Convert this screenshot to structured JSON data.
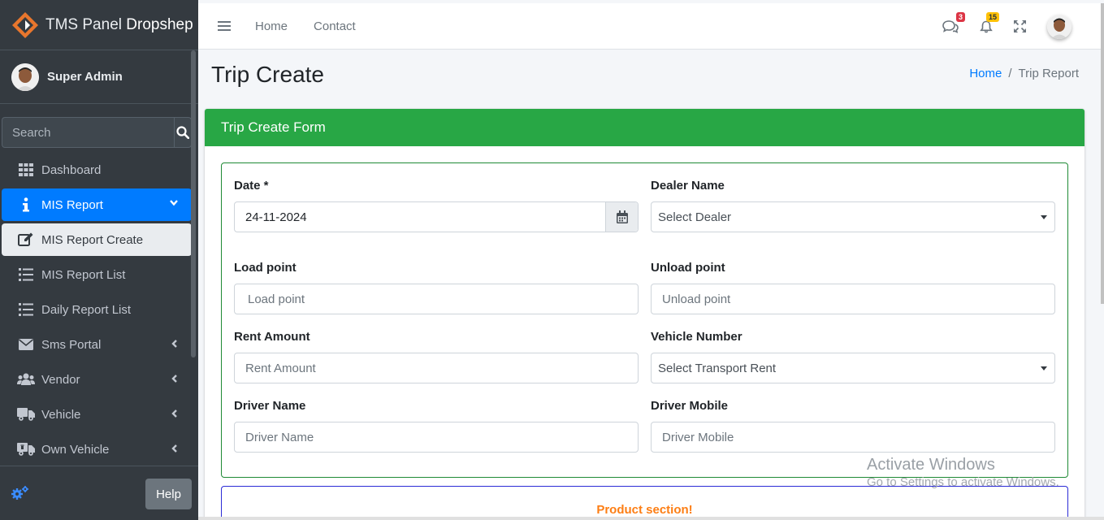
{
  "brand": {
    "name_light": "TMS Panel",
    "name_bold": "Dropshep"
  },
  "user": {
    "name": "Super Admin"
  },
  "sidebar": {
    "search_placeholder": "Search",
    "items": [
      {
        "label": "Dashboard",
        "icon": "th-icon"
      },
      {
        "label": "MIS Report",
        "icon": "info-icon"
      },
      {
        "label": "MIS Report Create",
        "icon": "edit-icon"
      },
      {
        "label": "MIS Report List",
        "icon": "list-icon"
      },
      {
        "label": "Daily Report List",
        "icon": "list-icon"
      },
      {
        "label": "Sms Portal",
        "icon": "envelope-icon"
      },
      {
        "label": "Vendor",
        "icon": "users-icon"
      },
      {
        "label": "Vehicle",
        "icon": "truck-icon"
      },
      {
        "label": "Own Vehicle",
        "icon": "truck-icon"
      }
    ],
    "help_label": "Help"
  },
  "topnav": {
    "home": "Home",
    "contact": "Contact",
    "messages_count": "3",
    "notifications_count": "15"
  },
  "page": {
    "title": "Trip Create",
    "breadcrumb_home": "Home",
    "breadcrumb_sep": "/",
    "breadcrumb_current": "Trip Report"
  },
  "form": {
    "header": "Trip Create Form",
    "date_label": "Date *",
    "date_value": "24-11-2024",
    "dealer_label": "Dealer Name",
    "dealer_value": "Select Dealer",
    "load_label": "Load point",
    "load_placeholder": "Load point",
    "unload_label": "Unload point",
    "unload_placeholder": "Unload point",
    "rent_label": "Rent Amount",
    "rent_placeholder": "Rent Amount",
    "vehicle_label": "Vehicle Number",
    "vehicle_value": "Select Transport Rent",
    "driver_label": "Driver Name",
    "driver_placeholder": "Driver Name",
    "mobile_label": "Driver Mobile",
    "mobile_placeholder": "Driver Mobile",
    "product_section": "Product section!"
  },
  "watermark": {
    "line1": "Activate Windows",
    "line2": "Go to Settings to activate Windows."
  },
  "colors": {
    "sidebar": "#343a40",
    "primary": "#007bff",
    "success": "#28a745",
    "product": "#fd7e14"
  }
}
